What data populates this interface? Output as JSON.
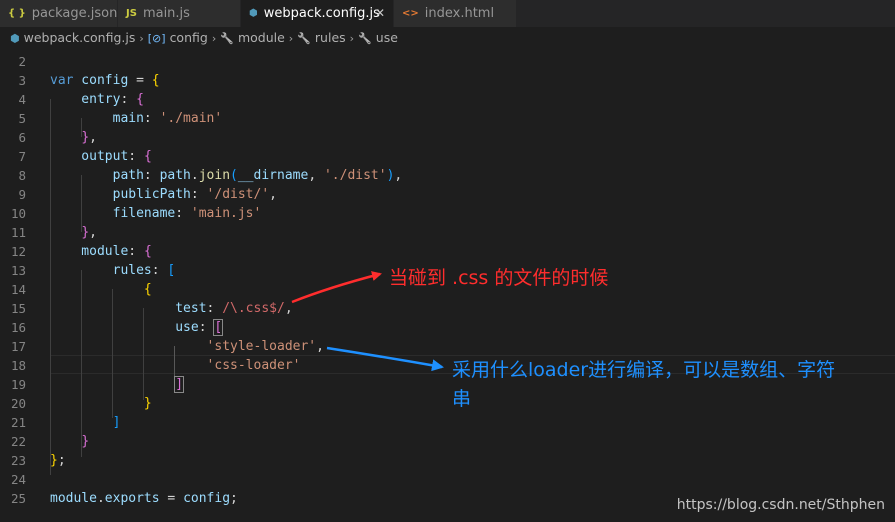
{
  "tabs": [
    {
      "label": "package.json",
      "icon": "{ }",
      "icon_color": "#cbcb41"
    },
    {
      "label": "main.js",
      "icon": "JS",
      "icon_color": "#cbcb41"
    },
    {
      "label": "webpack.config.js",
      "icon": "⬢",
      "icon_color": "#519aba",
      "active": true,
      "close": "✕"
    },
    {
      "label": "index.html",
      "icon": "<>",
      "icon_color": "#e37933"
    }
  ],
  "breadcrumb": [
    {
      "label": "webpack.config.js",
      "icon": "⬢"
    },
    {
      "label": "config",
      "icon": "[⊘]"
    },
    {
      "label": "module",
      "icon": "🔧"
    },
    {
      "label": "rules",
      "icon": "🔧"
    },
    {
      "label": "use",
      "icon": "🔧"
    }
  ],
  "breadcrumb_separator": "›",
  "line_numbers": [
    "2",
    "3",
    "4",
    "5",
    "6",
    "7",
    "8",
    "9",
    "10",
    "11",
    "12",
    "13",
    "14",
    "15",
    "16",
    "17",
    "18",
    "19",
    "20",
    "21",
    "22",
    "23",
    "24",
    "25"
  ],
  "code": [
    [],
    [
      {
        "t": "var",
        "c": "kw"
      },
      {
        "t": " config ",
        "c": "var"
      },
      {
        "t": "= ",
        "c": "p"
      },
      {
        "t": "{",
        "c": "b1"
      }
    ],
    [
      {
        "t": "    entry",
        "c": "var"
      },
      {
        "t": ": ",
        "c": "p"
      },
      {
        "t": "{",
        "c": "b2"
      }
    ],
    [
      {
        "t": "        main",
        "c": "var"
      },
      {
        "t": ": ",
        "c": "p"
      },
      {
        "t": "'./main'",
        "c": "str"
      }
    ],
    [
      {
        "t": "    ",
        "c": "p"
      },
      {
        "t": "}",
        "c": "b2"
      },
      {
        "t": ",",
        "c": "p"
      }
    ],
    [
      {
        "t": "    output",
        "c": "var"
      },
      {
        "t": ": ",
        "c": "p"
      },
      {
        "t": "{",
        "c": "b2"
      }
    ],
    [
      {
        "t": "        path",
        "c": "var"
      },
      {
        "t": ": ",
        "c": "p"
      },
      {
        "t": "path",
        "c": "var"
      },
      {
        "t": ".",
        "c": "p"
      },
      {
        "t": "join",
        "c": "fn"
      },
      {
        "t": "(",
        "c": "b3"
      },
      {
        "t": "__dirname",
        "c": "var"
      },
      {
        "t": ", ",
        "c": "p"
      },
      {
        "t": "'./dist'",
        "c": "str"
      },
      {
        "t": ")",
        "c": "b3"
      },
      {
        "t": ",",
        "c": "p"
      }
    ],
    [
      {
        "t": "        publicPath",
        "c": "var"
      },
      {
        "t": ": ",
        "c": "p"
      },
      {
        "t": "'/dist/'",
        "c": "str"
      },
      {
        "t": ",",
        "c": "p"
      }
    ],
    [
      {
        "t": "        filename",
        "c": "var"
      },
      {
        "t": ": ",
        "c": "p"
      },
      {
        "t": "'main.js'",
        "c": "str"
      }
    ],
    [
      {
        "t": "    ",
        "c": "p"
      },
      {
        "t": "}",
        "c": "b2"
      },
      {
        "t": ",",
        "c": "p"
      }
    ],
    [
      {
        "t": "    module",
        "c": "var"
      },
      {
        "t": ": ",
        "c": "p"
      },
      {
        "t": "{",
        "c": "b2"
      }
    ],
    [
      {
        "t": "        rules",
        "c": "var"
      },
      {
        "t": ": ",
        "c": "p"
      },
      {
        "t": "[",
        "c": "b3"
      }
    ],
    [
      {
        "t": "            ",
        "c": "p"
      },
      {
        "t": "{",
        "c": "b1"
      }
    ],
    [
      {
        "t": "                test",
        "c": "var"
      },
      {
        "t": ": ",
        "c": "p"
      },
      {
        "t": "/\\.css$/",
        "c": "re"
      },
      {
        "t": ",",
        "c": "p"
      }
    ],
    [
      {
        "t": "                use",
        "c": "var"
      },
      {
        "t": ": ",
        "c": "p"
      },
      {
        "t": "[",
        "c": "b2",
        "m": true
      }
    ],
    [
      {
        "t": "                    ",
        "c": "p"
      },
      {
        "t": "'style-loader'",
        "c": "str"
      },
      {
        "t": ",",
        "c": "p"
      }
    ],
    [
      {
        "t": "                    ",
        "c": "p"
      },
      {
        "t": "'css-loader'",
        "c": "str"
      }
    ],
    [
      {
        "t": "                ",
        "c": "p"
      },
      {
        "t": "]",
        "c": "b2",
        "m": true
      }
    ],
    [
      {
        "t": "            ",
        "c": "p"
      },
      {
        "t": "}",
        "c": "b1"
      }
    ],
    [
      {
        "t": "        ",
        "c": "p"
      },
      {
        "t": "]",
        "c": "b3"
      }
    ],
    [
      {
        "t": "    ",
        "c": "p"
      },
      {
        "t": "}",
        "c": "b2"
      }
    ],
    [
      {
        "t": "}",
        "c": "b1"
      },
      {
        "t": ";",
        "c": "p"
      }
    ],
    [],
    [
      {
        "t": "module",
        "c": "var"
      },
      {
        "t": ".",
        "c": "p"
      },
      {
        "t": "exports",
        "c": "var"
      },
      {
        "t": " = ",
        "c": "p"
      },
      {
        "t": "config",
        "c": "var"
      },
      {
        "t": ";",
        "c": "p"
      }
    ]
  ],
  "annotations": {
    "css_match": {
      "text": "当碰到 .css 的文件的时候",
      "color": "#ff2d2d"
    },
    "loader_use_line1": {
      "text": "采用什么loader进行编译，可以是数组、字符",
      "color": "#1e90ff"
    },
    "loader_use_line2": {
      "text": "串",
      "color": "#1e90ff"
    }
  },
  "watermark": "https://blog.csdn.net/Sthphen",
  "colors": {
    "editor_bg": "#1e1e1e",
    "tab_bg": "#2d2d2d",
    "active_tab_bg": "#1e1e1e"
  }
}
